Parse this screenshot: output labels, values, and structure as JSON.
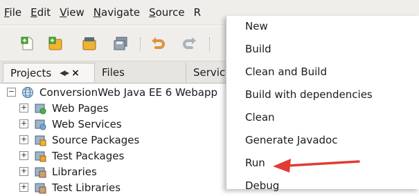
{
  "menubar": {
    "items": [
      {
        "label": "File",
        "mnemonic": "F",
        "rest": "ile"
      },
      {
        "label": "Edit",
        "mnemonic": "E",
        "rest": "dit"
      },
      {
        "label": "View",
        "mnemonic": "V",
        "rest": "iew"
      },
      {
        "label": "Navigate",
        "mnemonic": "N",
        "rest": "avigate"
      },
      {
        "label": "Source",
        "mnemonic": "S",
        "rest": "ource"
      },
      {
        "label": "R",
        "mnemonic": "",
        "rest": "R"
      }
    ]
  },
  "toolbar": {
    "icons": [
      "new-file-icon",
      "new-project-icon",
      "open-project-icon",
      "save-all-icon",
      "undo-icon",
      "redo-icon"
    ]
  },
  "tabs": [
    {
      "label": "Projects",
      "active": true,
      "controls": "◀▸",
      "close": "×"
    },
    {
      "label": "Files",
      "active": false
    },
    {
      "label": "Servic",
      "active": false
    }
  ],
  "tree": {
    "root": {
      "label": "ConversionWeb Java EE 6 Webapp",
      "expander": "−",
      "icon": "globe-project-icon"
    },
    "children": [
      {
        "label": "Web Pages",
        "expander": "+",
        "icon": "web-pages-icon"
      },
      {
        "label": "Web Services",
        "expander": "+",
        "icon": "web-services-icon"
      },
      {
        "label": "Source Packages",
        "expander": "+",
        "icon": "source-packages-icon"
      },
      {
        "label": "Test Packages",
        "expander": "+",
        "icon": "test-packages-icon"
      },
      {
        "label": "Libraries",
        "expander": "+",
        "icon": "libraries-icon"
      },
      {
        "label": "Test Libraries",
        "expander": "+",
        "icon": "test-libraries-icon"
      }
    ]
  },
  "context_menu": {
    "items": [
      "New",
      "Build",
      "Clean and Build",
      "Build with dependencies",
      "Clean",
      "Generate Javadoc",
      "Run",
      "Debug"
    ]
  },
  "annotation": {
    "type": "red-arrow",
    "points_to": "Run",
    "color": "#e03c31"
  },
  "colors": {
    "chrome": "#efeeeb",
    "tabs": "#e6e5e1",
    "popup": "#ffffff",
    "arrow": "#e03c31"
  }
}
